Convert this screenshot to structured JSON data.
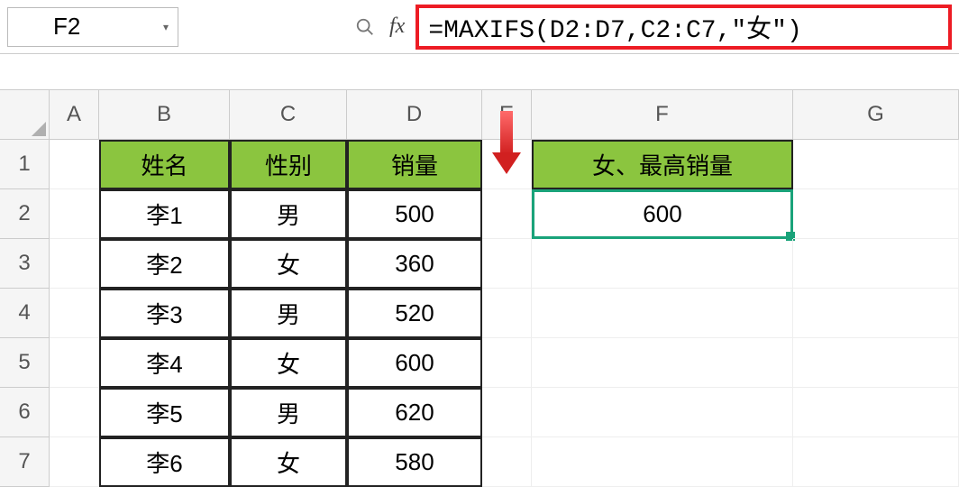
{
  "nameBox": {
    "value": "F2"
  },
  "formula": {
    "value": "=MAXIFS(D2:D7,C2:C7,\"女\")"
  },
  "columns": [
    "A",
    "B",
    "C",
    "D",
    "E",
    "F",
    "G"
  ],
  "rows": [
    "1",
    "2",
    "3",
    "4",
    "5",
    "6",
    "7"
  ],
  "table": {
    "headers": {
      "B": "姓名",
      "C": "性别",
      "D": "销量"
    },
    "rows": [
      {
        "B": "李1",
        "C": "男",
        "D": "500"
      },
      {
        "B": "李2",
        "C": "女",
        "D": "360"
      },
      {
        "B": "李3",
        "C": "男",
        "D": "520"
      },
      {
        "B": "李4",
        "C": "女",
        "D": "600"
      },
      {
        "B": "李5",
        "C": "男",
        "D": "620"
      },
      {
        "B": "李6",
        "C": "女",
        "D": "580"
      }
    ]
  },
  "result": {
    "header": "女、最高销量",
    "value": "600"
  },
  "fxLabel": "fx",
  "colors": {
    "tableHeader": "#8bc53f",
    "selection": "#1aa37a",
    "highlightBorder": "#ed1c24"
  }
}
